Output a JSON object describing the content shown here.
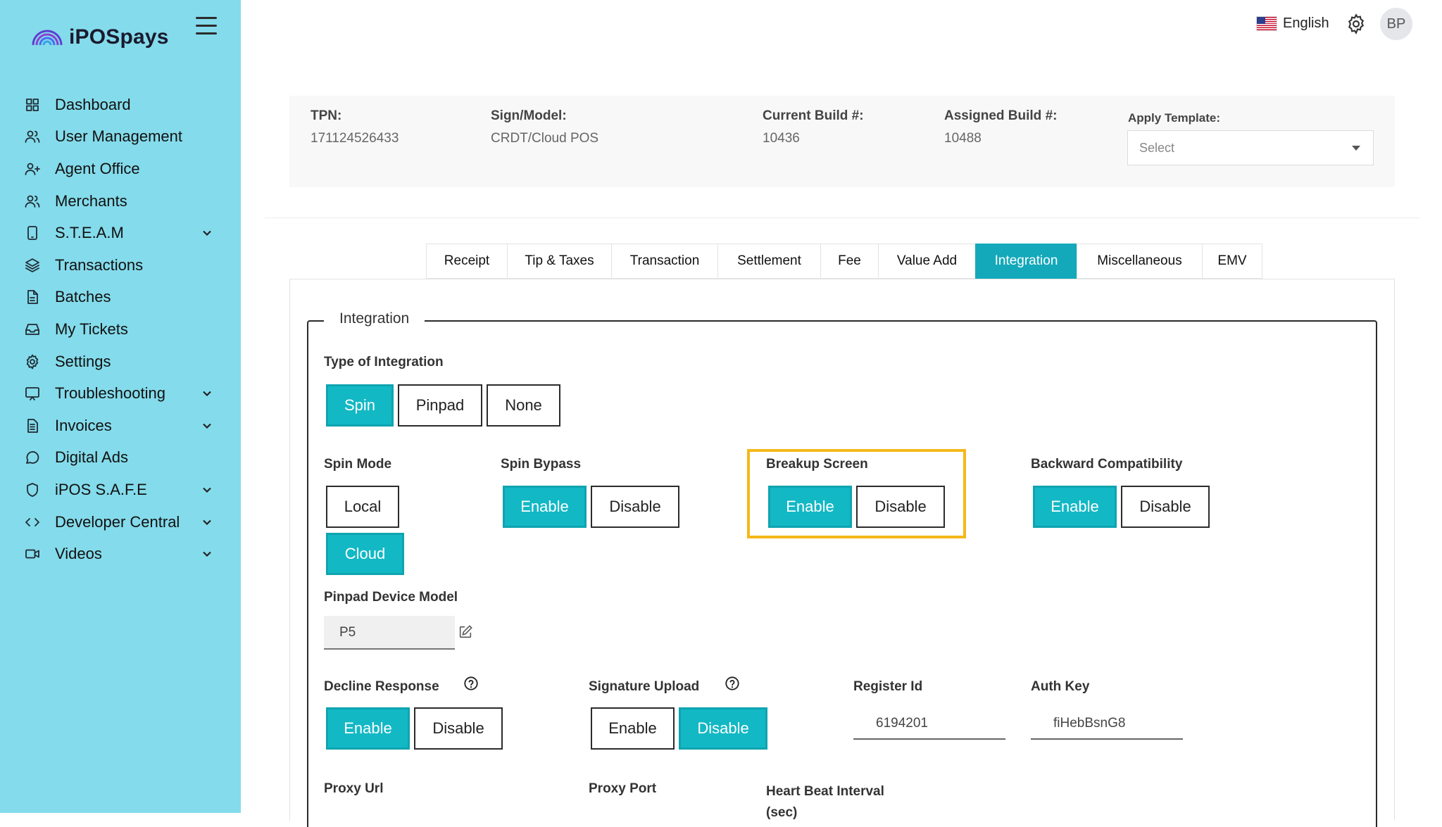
{
  "app": {
    "name": "iPOSpays"
  },
  "sidebar": {
    "items": [
      {
        "label": "Dashboard",
        "icon": "dashboard-icon",
        "chevron": false
      },
      {
        "label": "User Management",
        "icon": "users-icon",
        "chevron": false
      },
      {
        "label": "Agent Office",
        "icon": "user-plus-icon",
        "chevron": false
      },
      {
        "label": "Merchants",
        "icon": "merchants-icon",
        "chevron": false
      },
      {
        "label": "S.T.E.A.M",
        "icon": "device-icon",
        "chevron": true
      },
      {
        "label": "Transactions",
        "icon": "layers-icon",
        "chevron": false
      },
      {
        "label": "Batches",
        "icon": "file-icon",
        "chevron": false
      },
      {
        "label": "My Tickets",
        "icon": "inbox-icon",
        "chevron": false
      },
      {
        "label": "Settings",
        "icon": "gear-icon",
        "chevron": false
      },
      {
        "label": "Troubleshooting",
        "icon": "monitor-icon",
        "chevron": true
      },
      {
        "label": "Invoices",
        "icon": "invoice-icon",
        "chevron": true
      },
      {
        "label": "Digital Ads",
        "icon": "chat-icon",
        "chevron": false
      },
      {
        "label": "iPOS S.A.F.E",
        "icon": "shield-icon",
        "chevron": true
      },
      {
        "label": "Developer Central",
        "icon": "code-icon",
        "chevron": true
      },
      {
        "label": "Videos",
        "icon": "video-icon",
        "chevron": true
      }
    ]
  },
  "topbar": {
    "language": "English",
    "avatar_initials": "BP"
  },
  "info": {
    "tpn_label": "TPN:",
    "tpn_value": "171124526433",
    "model_label": "Sign/Model:",
    "model_value": "CRDT/Cloud POS",
    "current_build_label": "Current Build #:",
    "current_build_value": "10436",
    "assigned_build_label": "Assigned Build #:",
    "assigned_build_value": "10488",
    "template_label": "Apply Template:",
    "template_placeholder": "Select"
  },
  "tabs": [
    {
      "label": "Receipt",
      "active": false
    },
    {
      "label": "Tip & Taxes",
      "active": false
    },
    {
      "label": "Transaction",
      "active": false
    },
    {
      "label": "Settlement",
      "active": false
    },
    {
      "label": "Fee",
      "active": false
    },
    {
      "label": "Value Add",
      "active": false
    },
    {
      "label": "Integration",
      "active": true
    },
    {
      "label": "Miscellaneous",
      "active": false
    },
    {
      "label": "EMV",
      "active": false
    }
  ],
  "integration": {
    "legend": "Integration",
    "type_label": "Type of Integration",
    "type_options": [
      "Spin",
      "Pinpad",
      "None"
    ],
    "type_selected": "Spin",
    "spin_mode_label": "Spin Mode",
    "spin_mode_options": [
      "Local",
      "Cloud"
    ],
    "spin_mode_selected": "Cloud",
    "spin_bypass_label": "Spin Bypass",
    "spin_bypass_selected": "Enable",
    "breakup_label": "Breakup Screen",
    "breakup_selected": "Enable",
    "backward_label": "Backward Compatibility",
    "backward_selected": "Enable",
    "enable_label": "Enable",
    "disable_label": "Disable",
    "pinpad_model_label": "Pinpad Device Model",
    "pinpad_model_value": "P5",
    "decline_label": "Decline Response",
    "decline_selected": "Enable",
    "signature_label": "Signature Upload",
    "signature_selected": "Disable",
    "register_label": "Register Id",
    "register_value": "6194201",
    "auth_label": "Auth Key",
    "auth_value": "fiHebBsnG8",
    "proxy_url_label": "Proxy Url",
    "proxy_port_label": "Proxy Port",
    "heartbeat_label": "Heart Beat Interval (sec)"
  },
  "colors": {
    "sidebar": "#84dbeb",
    "accent": "#13a9ba",
    "highlight": "#f4b81a"
  }
}
